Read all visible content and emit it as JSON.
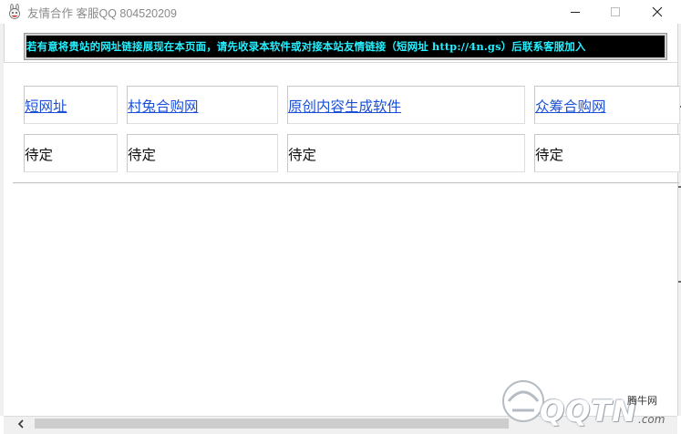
{
  "window": {
    "title": "友情合作 客服QQ 804520209",
    "icon": "bunny-app-icon",
    "controls": [
      "minimize-icon",
      "maximize-icon",
      "close-icon"
    ]
  },
  "banner": {
    "text": "若有意将贵站的网址链接展现在本页面，请先收录本软件或对接本站友情链接（短网址 http://4n.gs）后联系客服加入",
    "background": "#000000",
    "color": "#26f0ff"
  },
  "links": [
    {
      "label": "短网址",
      "status": "待定"
    },
    {
      "label": "村兔合购网",
      "status": "待定"
    },
    {
      "label": "原创内容生成软件",
      "status": "待定"
    },
    {
      "label": "众筹合购网",
      "status": "待定"
    }
  ],
  "watermark": {
    "logo": "QQTN",
    "cn": "腾牛网",
    "suffix": ".com"
  },
  "colors": {
    "link": "#1a4fd6",
    "accent": "#26f0ff"
  }
}
